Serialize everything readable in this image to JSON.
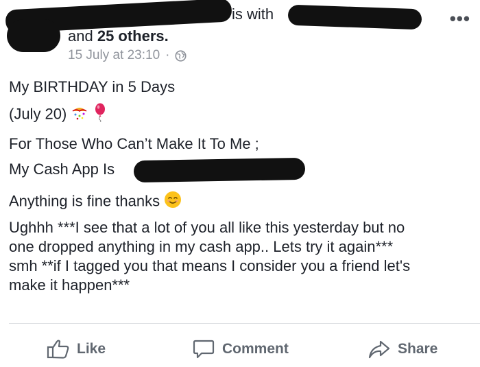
{
  "post": {
    "header_suffix": "is with",
    "others": "and 25 others.",
    "timestamp": "15 July at 23:10",
    "separator": "·",
    "privacy_icon": "globe-icon",
    "menu_label": "•••",
    "lines": [
      "My BIRTHDAY in 5 Days",
      "(July 20)",
      "For Those Who Can’t Make It To Me ;",
      "My Cash App Is",
      "Anything is fine thanks",
      "Ughhh ***I see that a lot of you all like this yesterday but no",
      "one dropped anything in my cash app.. Lets try it again***",
      "smh **if I tagged you that means I consider you a friend let's",
      "make it happen***"
    ]
  },
  "actions": {
    "like": "Like",
    "comment": "Comment",
    "share": "Share"
  },
  "colors": {
    "text": "#1d2129",
    "meta": "#90949c",
    "action": "#606770",
    "balloon": "#e0245e"
  }
}
